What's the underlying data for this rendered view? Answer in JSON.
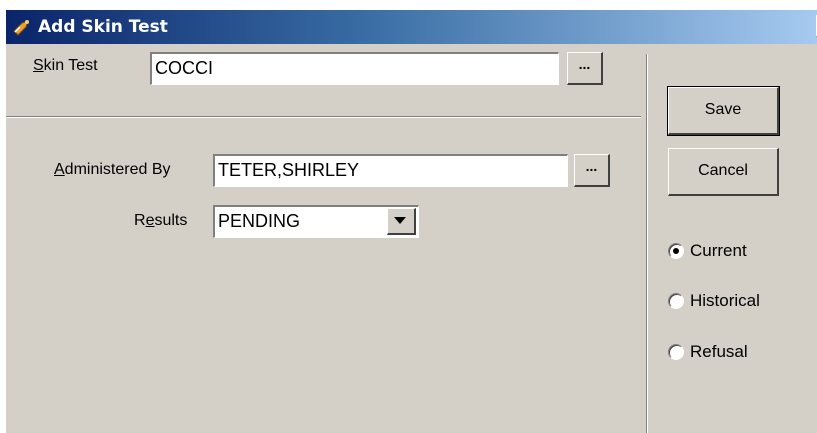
{
  "window": {
    "title": "Add Skin Test",
    "close_glyph": "×"
  },
  "skin_test": {
    "label_mnemonic": "S",
    "label_rest": "kin Test",
    "value": "COCCI",
    "browse_label": "..."
  },
  "administered_by": {
    "label_mnemonic": "A",
    "label_rest": "dministered By",
    "value": "TETER,SHIRLEY",
    "browse_label": "..."
  },
  "results": {
    "label_pre": "R",
    "label_mnemonic": "e",
    "label_rest": "sults",
    "selected": "PENDING"
  },
  "buttons": {
    "save": "Save",
    "cancel": "Cancel"
  },
  "status_options": [
    {
      "label": "Current",
      "selected": true
    },
    {
      "label": "Historical",
      "selected": false
    },
    {
      "label": "Refusal",
      "selected": false
    }
  ],
  "icons": {
    "app": "skin-test-app-icon",
    "close": "close-icon",
    "dropdown": "chevron-down-icon"
  }
}
